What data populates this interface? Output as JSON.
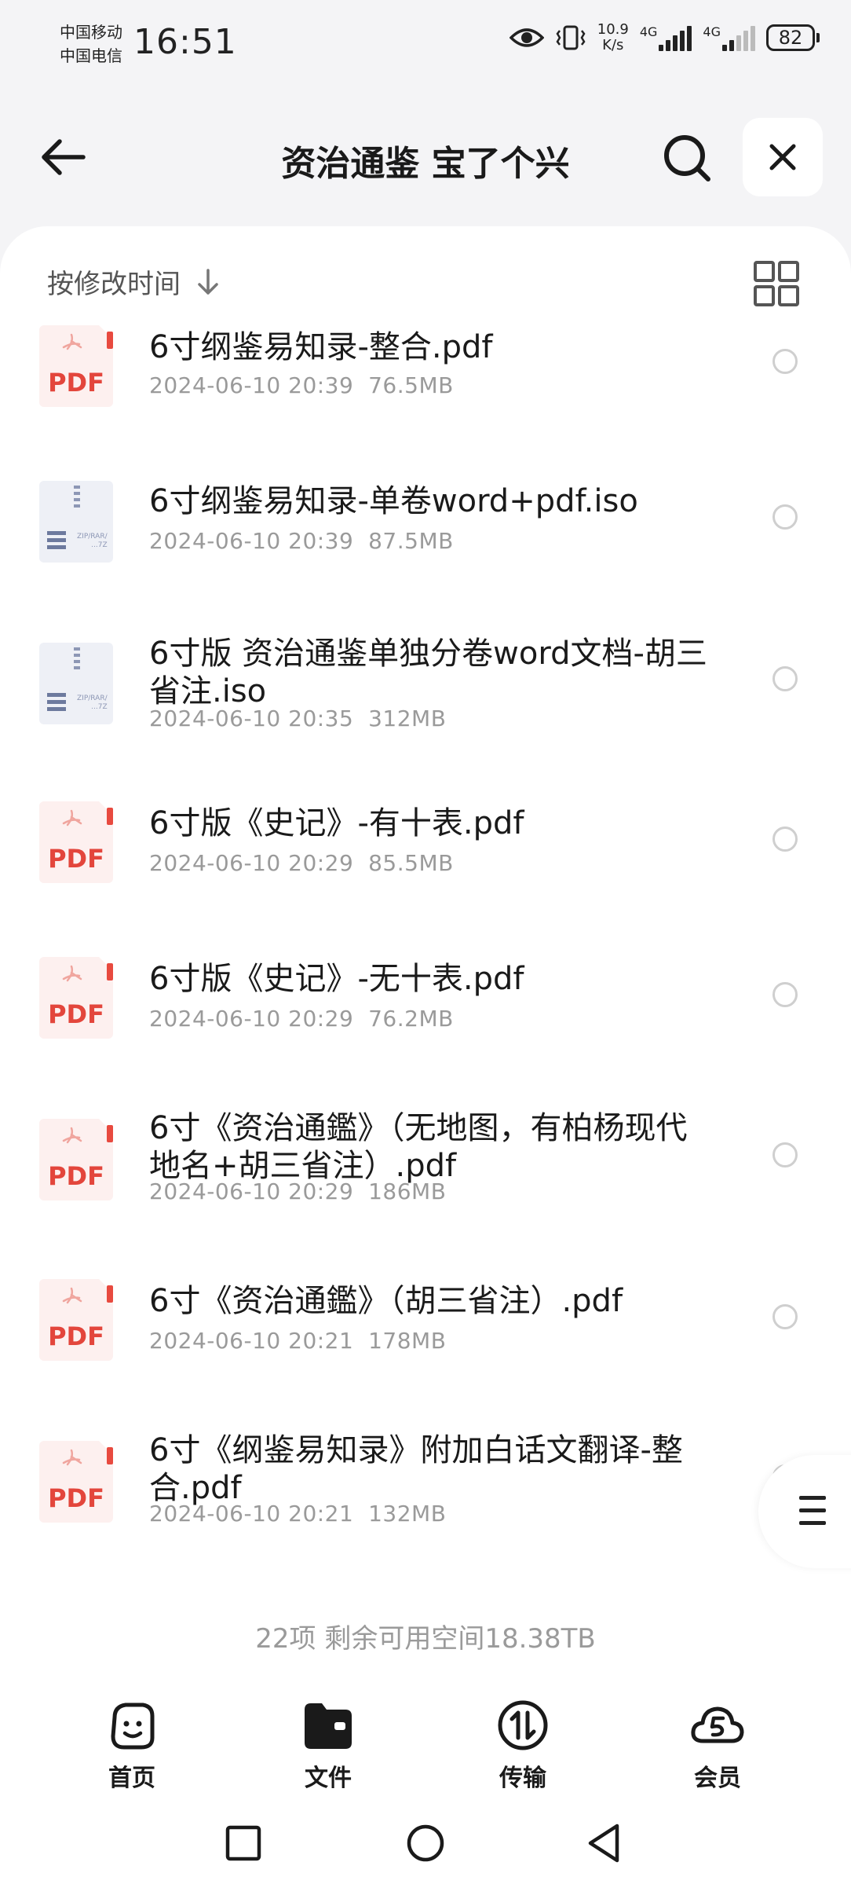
{
  "status_bar": {
    "carrier1": "中国移动",
    "carrier2": "中国电信",
    "time": "16:51",
    "speed_value": "10.9",
    "speed_unit": "K/s",
    "network1": "4G",
    "network2": "4G",
    "battery": "82"
  },
  "header": {
    "title": "资治通鉴 宝了个兴"
  },
  "toolbar": {
    "sort_label": "按修改时间"
  },
  "files": [
    {
      "type": "pdf",
      "name": "6寸纲鉴易知录-整合.pdf",
      "meta": "2024-06-10 20:39  76.5MB"
    },
    {
      "type": "iso",
      "name": "6寸纲鉴易知录-单卷word+pdf.iso",
      "meta": "2024-06-10 20:39  87.5MB"
    },
    {
      "type": "iso",
      "name": "6寸版 资治通鉴单独分卷word文档-胡三省注.iso",
      "meta": "2024-06-10 20:35  312MB"
    },
    {
      "type": "pdf",
      "name": "6寸版《史记》-有十表.pdf",
      "meta": "2024-06-10 20:29  85.5MB"
    },
    {
      "type": "pdf",
      "name": "6寸版《史记》-无十表.pdf",
      "meta": "2024-06-10 20:29  76.2MB"
    },
    {
      "type": "pdf",
      "name": "6寸《资治通鑑》（无地图，有柏杨现代地名+胡三省注）.pdf",
      "meta": "2024-06-10 20:29  186MB"
    },
    {
      "type": "pdf",
      "name": "6寸《资治通鑑》（胡三省注）.pdf",
      "meta": "2024-06-10 20:21  178MB"
    },
    {
      "type": "pdf",
      "name": "6寸《纲鉴易知录》附加白话文翻译-整合.pdf",
      "meta": "2024-06-10 20:21  132MB"
    }
  ],
  "file_icon_text": {
    "pdf": "PDF",
    "iso_line1": "ZIP/RAR/",
    "iso_line2": "...7Z"
  },
  "summary": "22项 剩余可用空间18.38TB",
  "bottom_nav": [
    {
      "label": "首页",
      "icon": "home-face-icon"
    },
    {
      "label": "文件",
      "icon": "folder-icon"
    },
    {
      "label": "传输",
      "icon": "transfer-icon"
    },
    {
      "label": "会员",
      "icon": "cloud-member-icon"
    }
  ],
  "colors": {
    "pdf_red": "#e3463c",
    "background": "#f4f4f6",
    "panel": "#ffffff"
  }
}
